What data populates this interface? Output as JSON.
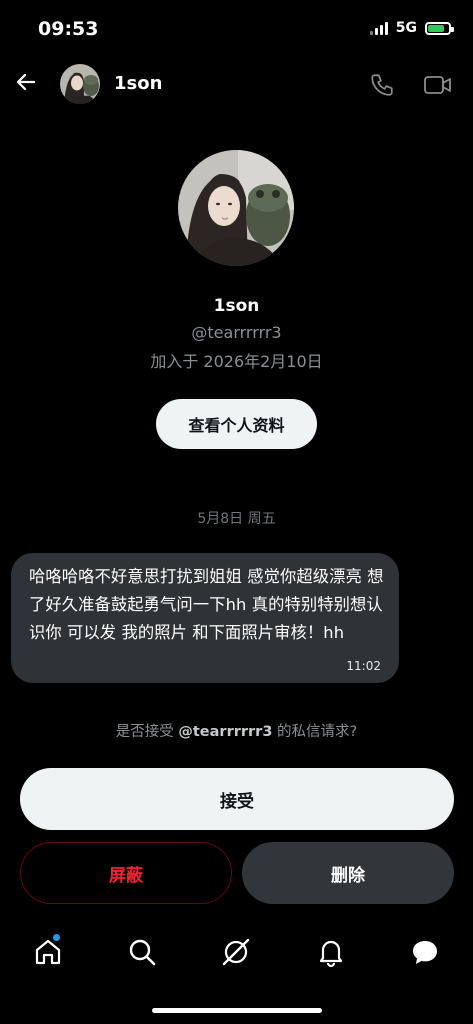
{
  "status_bar": {
    "time": "09:53",
    "network": "5G",
    "battery_level": 0.8,
    "battery_color": "#36c759"
  },
  "header": {
    "name": "1son"
  },
  "profile": {
    "name": "1son",
    "handle": "@tearrrrrr3",
    "joined": "加入于 2026年2月10日",
    "view_profile_label": "查看个人资料"
  },
  "conversation": {
    "date_separator": "5月8日 周五",
    "message": {
      "text": "哈咯哈咯不好意思打扰到姐姐 感觉你超级漂亮 想了好久准备鼓起勇气问一下hh 真的特别特别想认识你 可以发 我的照片 和下面照片审核！hh",
      "time": "11:02"
    }
  },
  "request": {
    "prefix": "是否接受 ",
    "handle": "@tearrrrrr3",
    "suffix": " 的私信请求?",
    "accept_label": "接受",
    "block_label": "屏蔽",
    "delete_label": "删除"
  },
  "tab_bar": {
    "items": [
      "home-icon",
      "search-icon",
      "grok-icon",
      "notifications-icon",
      "messages-icon"
    ]
  }
}
